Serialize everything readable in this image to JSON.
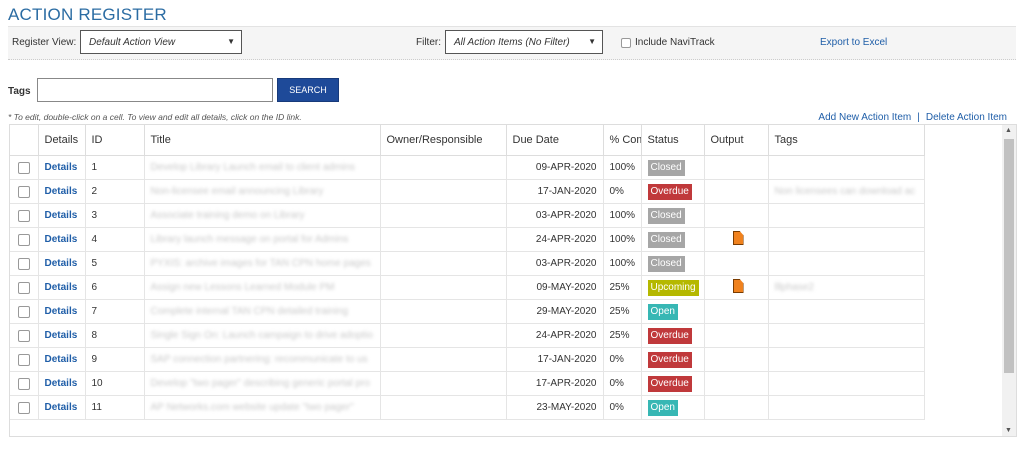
{
  "page": {
    "title": "ACTION REGISTER"
  },
  "toolbar": {
    "register_view_label": "Register View:",
    "register_view_value": "Default Action View",
    "filter_label": "Filter:",
    "filter_value": "All Action Items (No Filter)",
    "include_navitrack_label": "Include NaviTrack",
    "export_label": "Export to Excel"
  },
  "tags": {
    "label": "Tags",
    "value": "",
    "search_label": "SEARCH"
  },
  "note": "* To edit, double-click on a cell. To view and edit all details, click on the ID link.",
  "actions": {
    "add_label": "Add New Action Item",
    "separator": "|",
    "delete_label": "Delete Action Item"
  },
  "table": {
    "headers": [
      "Details",
      "ID",
      "Title",
      "Owner/Responsible",
      "Due Date",
      "% Com",
      "Status",
      "Output",
      "Tags"
    ],
    "rows": [
      {
        "details": "Details",
        "id": "1",
        "title": "Develop Library Launch email to client admins",
        "owner": "",
        "due": "09-APR-2020",
        "pct": "100%",
        "status": "Closed",
        "output": false,
        "tags": ""
      },
      {
        "details": "Details",
        "id": "2",
        "title": "Non-licensee email announcing Library",
        "owner": "",
        "due": "17-JAN-2020",
        "pct": "0%",
        "status": "Overdue",
        "output": false,
        "tags": "Non licensees can download ac"
      },
      {
        "details": "Details",
        "id": "3",
        "title": "Associate training demo on Library",
        "owner": "",
        "due": "03-APR-2020",
        "pct": "100%",
        "status": "Closed",
        "output": false,
        "tags": ""
      },
      {
        "details": "Details",
        "id": "4",
        "title": "Library launch message on portal for Admins",
        "owner": "",
        "due": "24-APR-2020",
        "pct": "100%",
        "status": "Closed",
        "output": true,
        "tags": ""
      },
      {
        "details": "Details",
        "id": "5",
        "title": "PYXIS: archive images for TAN CPN home pages",
        "owner": "",
        "due": "03-APR-2020",
        "pct": "100%",
        "status": "Closed",
        "output": false,
        "tags": ""
      },
      {
        "details": "Details",
        "id": "6",
        "title": "Assign new Lessons Learned Module PM",
        "owner": "",
        "due": "09-MAY-2020",
        "pct": "25%",
        "status": "Upcoming",
        "output": true,
        "tags": "lllphase2"
      },
      {
        "details": "Details",
        "id": "7",
        "title": "Complete internal TAN CPN detailed training",
        "owner": "",
        "due": "29-MAY-2020",
        "pct": "25%",
        "status": "Open",
        "output": false,
        "tags": ""
      },
      {
        "details": "Details",
        "id": "8",
        "title": "Single Sign On: Launch campaign to drive adoptio",
        "owner": "",
        "due": "24-APR-2020",
        "pct": "25%",
        "status": "Overdue",
        "output": false,
        "tags": ""
      },
      {
        "details": "Details",
        "id": "9",
        "title": "SAP connection partnering: recommunicate to us",
        "owner": "",
        "due": "17-JAN-2020",
        "pct": "0%",
        "status": "Overdue",
        "output": false,
        "tags": ""
      },
      {
        "details": "Details",
        "id": "10",
        "title": "Develop \"two pager\" describing generic portal pro",
        "owner": "",
        "due": "17-APR-2020",
        "pct": "0%",
        "status": "Overdue",
        "output": false,
        "tags": ""
      },
      {
        "details": "Details",
        "id": "11",
        "title": "AP Networks.com website update \"two pager\"",
        "owner": "",
        "due": "23-MAY-2020",
        "pct": "0%",
        "status": "Open",
        "output": false,
        "tags": ""
      }
    ]
  },
  "status_colors": {
    "Closed": "#a6a6a6",
    "Overdue": "#c0393b",
    "Upcoming": "#b5b800",
    "Open": "#37b7b4"
  },
  "icons": {
    "output": "document-icon",
    "dropdown": "chevron-down-icon"
  }
}
